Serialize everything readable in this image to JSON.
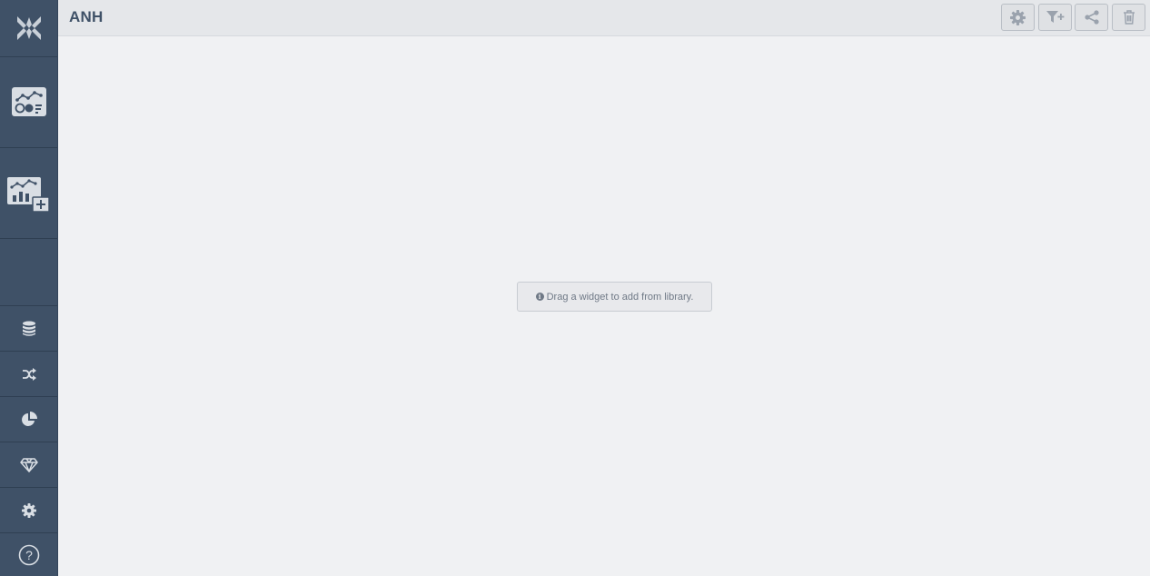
{
  "header": {
    "title": "ANH"
  },
  "toolbar": {
    "buttons": [
      {
        "icon": "gear-icon"
      },
      {
        "icon": "filter-add-icon"
      },
      {
        "icon": "share-icon"
      },
      {
        "icon": "trash-icon"
      }
    ]
  },
  "sidebar": {
    "items": [
      {
        "icon": "logo-icon"
      },
      {
        "icon": "dashboard-icon"
      },
      {
        "icon": "new-dashboard-icon"
      },
      {
        "icon": "database-icon"
      },
      {
        "icon": "shuffle-icon"
      },
      {
        "icon": "pie-chart-icon"
      },
      {
        "icon": "diamond-icon"
      },
      {
        "icon": "gear-icon"
      },
      {
        "icon": "help-icon"
      }
    ],
    "help_label": "?"
  },
  "main": {
    "hint_text": "Drag a widget to add from library.",
    "hint_icon_glyph": "i"
  },
  "colors": {
    "sidebar_bg": "#3f5167",
    "header_bg": "#e5e7ea",
    "canvas_bg": "#f0f1f3",
    "title_color": "#3f5167",
    "icon_light": "#d9dee4"
  }
}
